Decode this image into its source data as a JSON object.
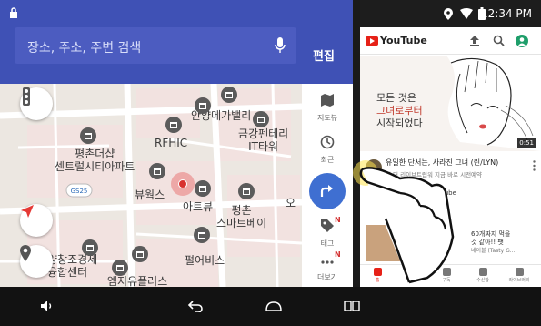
{
  "map_app": {
    "search_placeholder": "장소, 주소, 주변 검색",
    "edit_label": "편집",
    "places": [
      "안양메가밸리",
      "RFHIC",
      "금강펜테리\nIT타워",
      "평촌더샵\n센트럴시티아파트",
      "뷰웍스",
      "아트뷰",
      "평촌\n스마트베이",
      "양창조경제\n융합센터",
      "펄어비스",
      "엠지유플러스",
      "오"
    ],
    "side_items": [
      {
        "label": "지도뷰"
      },
      {
        "label": "최근"
      },
      {
        "label": "태그",
        "badge": "N"
      },
      {
        "label": "더보기",
        "badge": "N"
      }
    ],
    "colors": {
      "header": "#3f51b5",
      "direction_button": "#3f6fd1"
    }
  },
  "youtube": {
    "status_time": "12:34 PM",
    "logo_text": "YouTube",
    "thumbnail_poem": [
      "모든 것은",
      "그녀로부터",
      "시작되었다"
    ],
    "thumbnail_duration": "0:51",
    "video1_title": "유일한 단서는, 사라진 그녀 (린/LYN)",
    "video1_meta": "덤 더 리이브트럽워 지금 바로 시전예약",
    "video2_meta": "tube",
    "video3_text": [
      "60개짜지 먹을",
      "것 같아!! 팻",
      "네이블 (Tasty G..."
    ],
    "bottom_nav": [
      "홈",
      "인기",
      "구독",
      "수신함",
      "라이브러리"
    ],
    "colors": {
      "brand_red": "#e62117"
    }
  },
  "system_nav": {
    "icons": [
      "volume-icon",
      "back-icon",
      "home-icon",
      "recents-icon"
    ]
  }
}
